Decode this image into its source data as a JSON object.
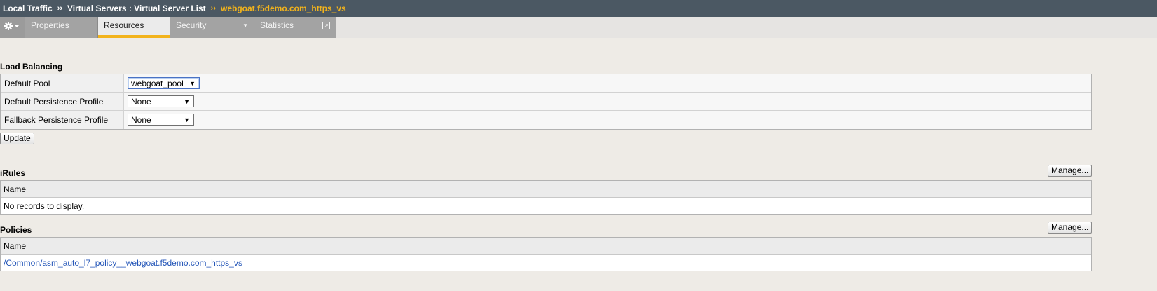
{
  "breadcrumb": {
    "items": [
      "Local Traffic",
      "Virtual Servers : Virtual Server List"
    ],
    "separator": "››",
    "current": "webgoat.f5demo.com_https_vs"
  },
  "tabs": {
    "gear_icon": "gear-icon",
    "items": [
      {
        "label": "Properties",
        "active": false
      },
      {
        "label": "Resources",
        "active": true
      },
      {
        "label": "Security",
        "active": false,
        "has_menu": true
      },
      {
        "label": "Statistics",
        "active": false,
        "popout": true
      }
    ]
  },
  "load_balancing": {
    "title": "Load Balancing",
    "rows": [
      {
        "label": "Default Pool",
        "value": "webgoat_pool"
      },
      {
        "label": "Default Persistence Profile",
        "value": "None"
      },
      {
        "label": "Fallback Persistence Profile",
        "value": "None"
      }
    ],
    "update_label": "Update"
  },
  "irules": {
    "title": "iRules",
    "manage_label": "Manage...",
    "column": "Name",
    "empty_text": "No records to display."
  },
  "policies": {
    "title": "Policies",
    "manage_label": "Manage...",
    "column": "Name",
    "rows": [
      "/Common/asm_auto_l7_policy__webgoat.f5demo.com_https_vs"
    ]
  },
  "colors": {
    "header_bg": "#4b5863",
    "accent": "#f2b31c",
    "link": "#2456b8"
  }
}
